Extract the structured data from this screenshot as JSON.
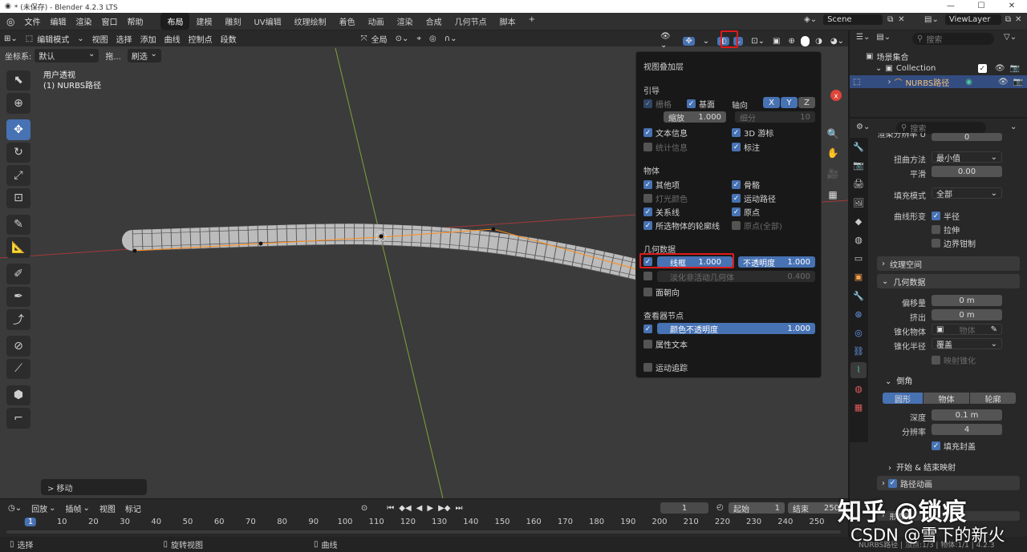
{
  "window": {
    "title": "* (未保存) - Blender 4.2.3 LTS",
    "controls": [
      "—",
      "☐",
      "✕"
    ]
  },
  "menu": [
    "文件",
    "编辑",
    "渲染",
    "窗口",
    "帮助"
  ],
  "workspaces": [
    "布局",
    "建模",
    "雕刻",
    "UV编辑",
    "纹理绘制",
    "着色",
    "动画",
    "渲染",
    "合成",
    "几何节点",
    "脚本"
  ],
  "active_workspace": "布局",
  "scene": "Scene",
  "viewlayer": "ViewLayer",
  "viewport_header": {
    "mode": "编辑模式",
    "menus": [
      "视图",
      "选择",
      "添加",
      "曲线",
      "控制点",
      "段数"
    ],
    "transform": "全局"
  },
  "header2": {
    "orientation_label": "坐标系:",
    "orientation": "默认",
    "drag_label": "拖...",
    "drag": "刷选"
  },
  "viewport_info": {
    "line1": "用户透视",
    "line2": "(1) NURBS路径"
  },
  "last_operator": "> 移动",
  "overlay": {
    "title": "视图叠加层",
    "guides": {
      "label": "引导",
      "grid": "栅格",
      "floor": "基面",
      "axes": "轴向",
      "x": "X",
      "y": "Y",
      "z": "Z",
      "scale_label": "缩放",
      "scale": "1.000",
      "subdiv_label": "细分",
      "subdiv": "10",
      "text_info": "文本信息",
      "cursor": "3D 游标",
      "stats": "统计信息",
      "annotations": "标注"
    },
    "objects": {
      "label": "物体",
      "extras": "其他项",
      "bones": "骨骼",
      "light_colors": "灯光颜色",
      "motion_paths": "运动路径",
      "relations": "关系线",
      "origins": "原点",
      "outline": "所选物体的轮廓线",
      "origins_all": "原点(全部)"
    },
    "geometry": {
      "label": "几何数据",
      "wireframe_label": "线框",
      "wireframe": "1.000",
      "opacity_label": "不透明度",
      "opacity": "1.000",
      "fade_label": "淡化非活动几何体",
      "fade": "0.400",
      "face_orient": "面朝向"
    },
    "viewer": {
      "label": "查看器节点",
      "color_opacity_label": "颜色不透明度",
      "color_opacity": "1.000",
      "attr_text": "属性文本"
    },
    "motion_tracking": "运动追踪"
  },
  "outliner": {
    "search_placeholder": "搜索",
    "scene_collection": "场景集合",
    "collection": "Collection",
    "object": "NURBS路径"
  },
  "properties": {
    "search_placeholder": "搜索",
    "top_cut": "渲染分辨率 U",
    "top_cut_val": "0",
    "twist_label": "扭曲方法",
    "twist": "最小值",
    "smooth_label": "平滑",
    "smooth": "0.00",
    "fill_label": "填充模式",
    "fill": "全部",
    "deform_label": "曲线形变",
    "radius": "半径",
    "stretch": "拉伸",
    "bounds": "边界钳制",
    "texspace": "纹理空间",
    "geometry": "几何数据",
    "offset_label": "偏移量",
    "offset": "0 m",
    "extrude_label": "挤出",
    "extrude": "0 m",
    "taper_obj_label": "锥化物体",
    "taper_obj": "物体",
    "taper_rad_label": "锥化半径",
    "taper_rad": "覆盖",
    "map_taper": "映射锥化",
    "bevel": "倒角",
    "bevel_modes": [
      "圆形",
      "物体",
      "轮廓"
    ],
    "depth_label": "深度",
    "depth": "0.1 m",
    "res_label": "分辨率",
    "res": "4",
    "fill_caps": "填充封盖",
    "start_end": "开始 & 结束映射",
    "path_anim": "路径动画",
    "shape_keys_cut": "形态键"
  },
  "timeline": {
    "menus": [
      "回放",
      "插帧",
      "视图",
      "标记"
    ],
    "current": "1",
    "start_label": "起始",
    "start": "1",
    "end_label": "结束",
    "end": "250",
    "ticks": [
      "1",
      "10",
      "20",
      "30",
      "40",
      "50",
      "60",
      "70",
      "80",
      "90",
      "100",
      "110",
      "120",
      "130",
      "140",
      "150",
      "160",
      "170",
      "180",
      "190",
      "200",
      "210",
      "220",
      "230",
      "240",
      "250"
    ]
  },
  "status": {
    "select": "选择",
    "rotate": "旋转视图",
    "curve": "曲线",
    "right": "NURBS路径 | 顶点:1/3 | 物体:1/1 | 4.2.3"
  },
  "watermark": {
    "zhihu": "知乎 @锁痕",
    "csdn": "CSDN @雪下的新火"
  },
  "colors": {
    "accent": "#4772b3",
    "highlight": "#e01a1a",
    "curve": "#ff8c1a"
  }
}
